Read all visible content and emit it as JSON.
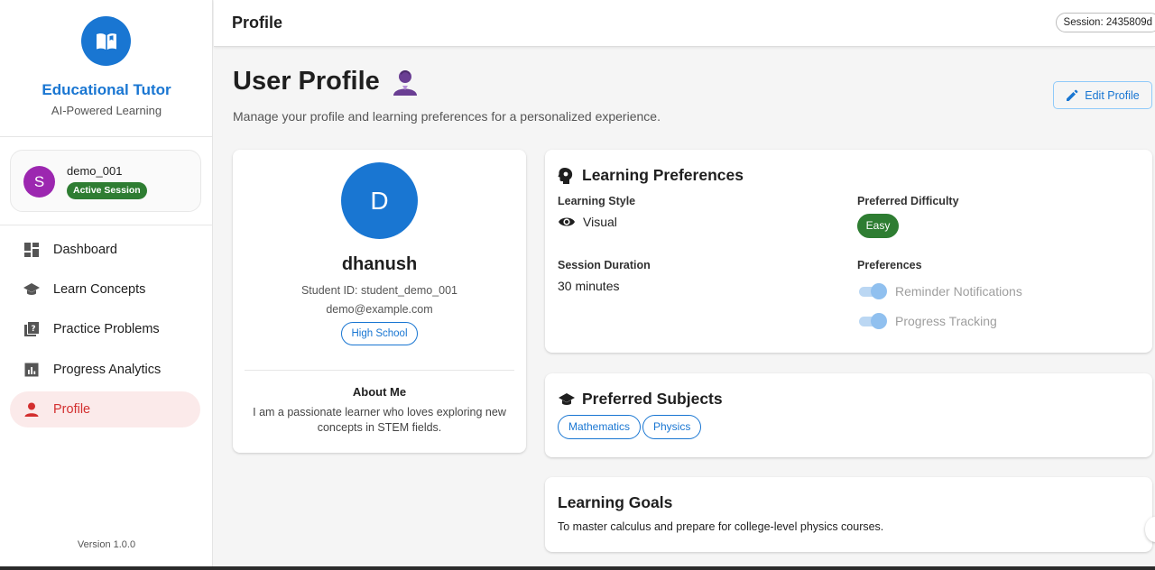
{
  "colors": {
    "primary": "#1976d2",
    "active_red": "#d32f2f",
    "success_green": "#2e7d32",
    "avatar_purple": "#9c27b0"
  },
  "sidebar": {
    "brand_title": "Educational Tutor",
    "brand_subtitle": "AI-Powered Learning",
    "brand_icon": "open-book-icon",
    "user": {
      "avatar_letter": "S",
      "name": "demo_001",
      "status": "Active Session"
    },
    "nav": [
      {
        "label": "Dashboard",
        "icon": "dashboard-icon",
        "active": false
      },
      {
        "label": "Learn Concepts",
        "icon": "graduation-cap-icon",
        "active": false
      },
      {
        "label": "Practice Problems",
        "icon": "quiz-icon",
        "active": false
      },
      {
        "label": "Progress Analytics",
        "icon": "analytics-icon",
        "active": false
      },
      {
        "label": "Profile",
        "icon": "person-icon",
        "active": true
      }
    ],
    "version": "Version 1.0.0"
  },
  "topbar": {
    "title": "Profile",
    "session": "Session: 2435809d"
  },
  "page": {
    "title": "User Profile",
    "title_icon": "person-icon",
    "subtitle": "Manage your profile and learning preferences for a personalized experience.",
    "edit_button": "Edit Profile"
  },
  "profile": {
    "avatar_letter": "D",
    "name": "dhanush",
    "student_id": "Student ID: student_demo_001",
    "email": "demo@example.com",
    "level": "High School",
    "about_title": "About Me",
    "about_text": "I am a passionate learner who loves exploring new concepts in STEM fields."
  },
  "preferences": {
    "title": "Learning Preferences",
    "learning_style_label": "Learning Style",
    "learning_style_value": "Visual",
    "difficulty_label": "Preferred Difficulty",
    "difficulty_value": "Easy",
    "session_duration_label": "Session Duration",
    "session_duration_value": "30 minutes",
    "preferences_label": "Preferences",
    "toggles": [
      {
        "label": "Reminder Notifications",
        "on": true,
        "disabled": true
      },
      {
        "label": "Progress Tracking",
        "on": true,
        "disabled": true
      }
    ]
  },
  "subjects": {
    "title": "Preferred Subjects",
    "items": [
      "Mathematics",
      "Physics"
    ]
  },
  "goals": {
    "title": "Learning Goals",
    "text": "To master calculus and prepare for college-level physics courses."
  }
}
